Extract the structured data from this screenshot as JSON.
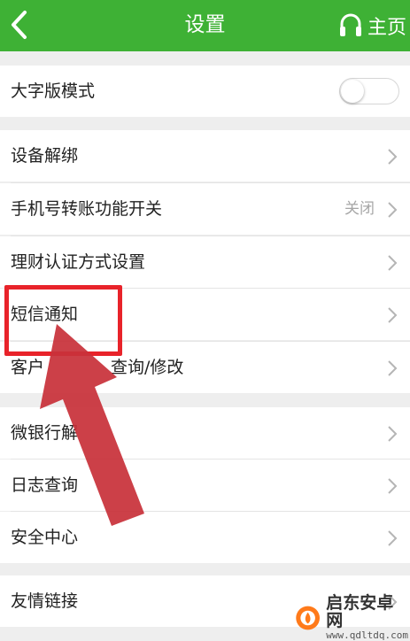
{
  "header": {
    "title": "设置",
    "home_label": "主页",
    "back_icon": "chevron-left-icon",
    "home_icon": "headset-icon",
    "bar_color": "#3eb135"
  },
  "groups": [
    {
      "rows": [
        {
          "label": "大字版模式",
          "control": "toggle",
          "toggle_on": false
        }
      ]
    },
    {
      "rows": [
        {
          "label": "设备解绑",
          "control": "chevron"
        },
        {
          "label": "手机号转账功能开关",
          "value": "关闭",
          "control": "chevron"
        },
        {
          "label": "理财认证方式设置",
          "control": "chevron"
        },
        {
          "label": "短信通知",
          "control": "chevron"
        },
        {
          "label": "客户",
          "label_suffix": "查询/修改",
          "control": "chevron"
        }
      ]
    },
    {
      "rows": [
        {
          "label": "微银行解",
          "control": "chevron"
        },
        {
          "label": "日志查询",
          "control": "chevron"
        },
        {
          "label": "安全中心",
          "control": "chevron"
        }
      ]
    },
    {
      "rows": [
        {
          "label": "友情链接",
          "control": "chevron"
        }
      ]
    }
  ],
  "annotation": {
    "color": "#e8232a",
    "arrow_color": "#c8323a"
  },
  "watermark": {
    "name": "启东安卓网",
    "url": "www.qdltdq.com"
  }
}
